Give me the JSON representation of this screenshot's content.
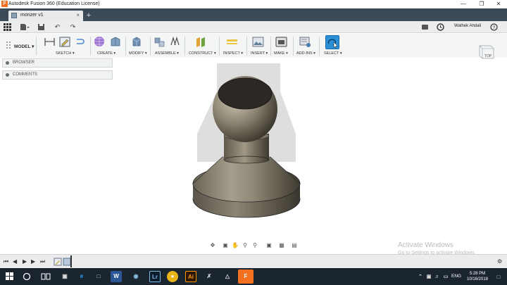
{
  "window": {
    "title": "Autodesk Fusion 360 (Education License)",
    "app_icon": "F"
  },
  "document_tab": {
    "name": "monzer v1",
    "close": "×",
    "new_tab": "+"
  },
  "quick_access": {
    "user": "Wathek Ahdali",
    "help": "?"
  },
  "ribbon": {
    "workspace": "MODEL ▾",
    "groups": {
      "sketch": "SKETCH ▾",
      "create": "CREATE ▾",
      "modify": "MODIFY ▾",
      "assemble": "ASSEMBLE ▾",
      "construct": "CONSTRUCT ▾",
      "inspect": "INSPECT ▾",
      "insert": "INSERT ▾",
      "make": "MAKE ▾",
      "addins": "ADD-INS ▾",
      "select": "SELECT ▾"
    }
  },
  "panels": {
    "browser": "BROWSER",
    "comments": "COMMENTS"
  },
  "viewcube": {
    "face": "TOP"
  },
  "watermark": {
    "line1": "Activate Windows",
    "line2": "Go to Settings to activate Windows."
  },
  "taskbar": {
    "tray_language": "ENG",
    "time": "5:28 PM",
    "date": "10/16/2018",
    "apps": [
      "Lr",
      "Ai",
      "F"
    ]
  },
  "colors": {
    "accent": "#2b8fd6",
    "titlebar_dark": "#3c4a57",
    "taskbar": "#1b2530"
  }
}
